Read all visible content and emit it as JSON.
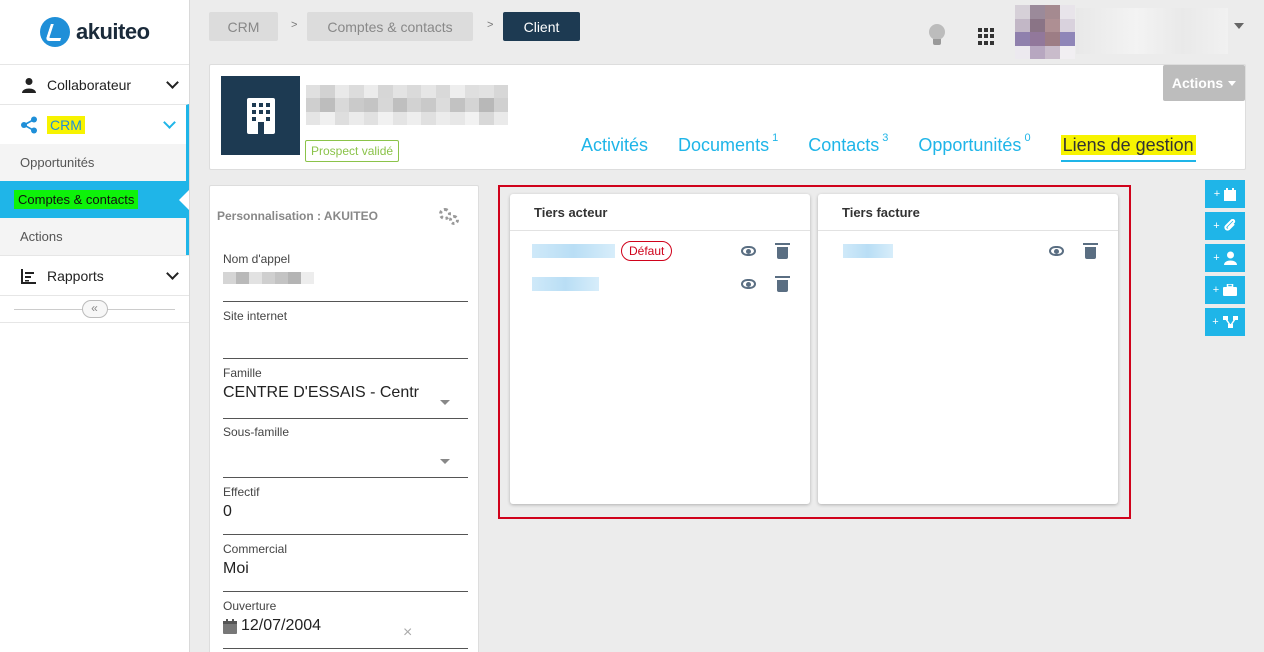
{
  "app": {
    "logo_text": "akuiteo"
  },
  "sidebar": {
    "items": [
      {
        "label": "Collaborateur",
        "icon": "person-icon"
      },
      {
        "label": "CRM",
        "icon": "share-icon"
      },
      {
        "label": "Rapports",
        "icon": "report-icon"
      }
    ],
    "crm_sub": [
      "Opportunités",
      "Comptes & contacts",
      "Actions"
    ],
    "collapse_glyph": "«"
  },
  "breadcrumb": [
    "CRM",
    "Comptes & contacts",
    "Client"
  ],
  "breadcrumb_sep": ">",
  "header": {
    "status": "Prospect validé",
    "actions_label": "Actions",
    "tabs": [
      {
        "label": "Activités",
        "count": ""
      },
      {
        "label": "Documents",
        "count": "1"
      },
      {
        "label": "Contacts",
        "count": "3"
      },
      {
        "label": "Opportunités",
        "count": "0"
      },
      {
        "label": "Liens de gestion",
        "count": ""
      }
    ]
  },
  "info_panel": {
    "title": "Personnalisation : AKUITEO",
    "fields": [
      {
        "label": "Nom d'appel",
        "value": ""
      },
      {
        "label": "Site internet",
        "value": ""
      },
      {
        "label": "Famille",
        "value": "CENTRE D'ESSAIS - Centr"
      },
      {
        "label": "Sous-famille",
        "value": ""
      },
      {
        "label": "Effectif",
        "value": "0"
      },
      {
        "label": "Commercial",
        "value": "Moi"
      },
      {
        "label": "Ouverture",
        "value": "12/07/2004"
      }
    ],
    "clear_glyph": "×"
  },
  "tiers": {
    "acteur_title": "Tiers acteur",
    "facture_title": "Tiers facture",
    "default_badge": "Défaut"
  },
  "side_buttons": [
    "calendar-icon",
    "paperclip-icon",
    "person-icon",
    "briefcase-icon",
    "share-icon"
  ],
  "side_plus": "+"
}
